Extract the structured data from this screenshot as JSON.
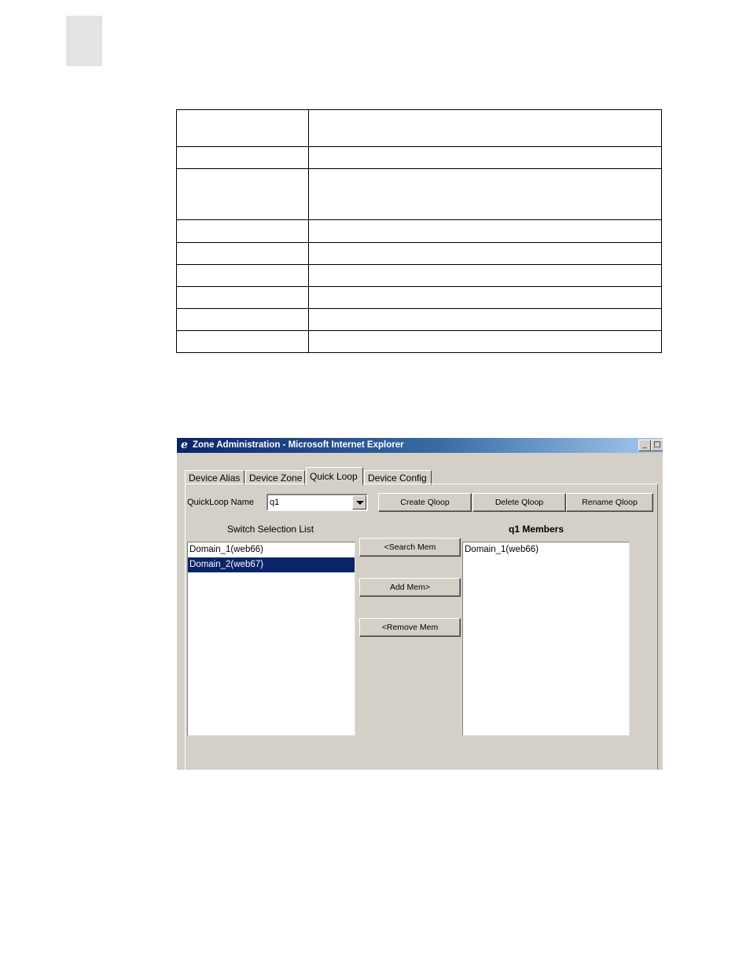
{
  "window": {
    "title": "Zone Administration - Microsoft Internet Explorer",
    "minimize_glyph": "_",
    "maximize_glyph": "□"
  },
  "tabs": [
    {
      "label": "Device Alias",
      "active": false
    },
    {
      "label": "Device Zone",
      "active": false
    },
    {
      "label": "Quick Loop",
      "active": true
    },
    {
      "label": "Device Config",
      "active": false
    }
  ],
  "quickloop": {
    "name_label": "QuickLoop Name",
    "selected_value": "q1",
    "create_button": "Create Qloop",
    "delete_button": "Delete Qloop",
    "rename_button": "Rename Qloop"
  },
  "switch_list": {
    "heading": "Switch Selection List",
    "items": [
      {
        "label": "Domain_1(web66)",
        "selected": false
      },
      {
        "label": "Domain_2(web67)",
        "selected": true
      }
    ]
  },
  "actions": {
    "search_mem": "<Search Mem",
    "add_mem": "Add Mem>",
    "remove_mem": "<Remove Mem"
  },
  "members": {
    "heading": "q1 Members",
    "items": [
      {
        "label": "Domain_1(web66)"
      }
    ]
  }
}
